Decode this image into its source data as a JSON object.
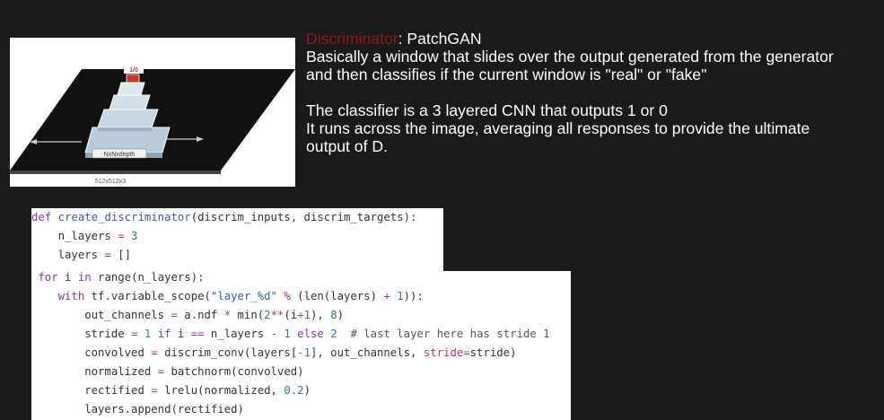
{
  "diagram": {
    "output_label": "1/0",
    "layer_label": "NxNxdepth",
    "image_label": "512x512x3"
  },
  "description": {
    "title_accent": "Discriminator",
    "title_rest": ": PatchGAN",
    "paragraph1": "Basically a window that slides over the output generated from the generator and then classifies if the current window is \"real\" or \"fake\"",
    "paragraph2_line1": "The classifier is a 3 layered CNN that outputs 1 or 0",
    "paragraph2_line2": "It runs across the image, averaging all responses to provide the ultimate output of D."
  },
  "code": {
    "block1": [
      [
        [
          "kw",
          "def"
        ],
        [
          "t",
          " "
        ],
        [
          "fn",
          "create_discriminator"
        ],
        [
          "t",
          "(discrim_inputs, discrim_targets):"
        ]
      ],
      [
        [
          "t",
          "    n_layers "
        ],
        [
          "op",
          "="
        ],
        [
          "t",
          " "
        ],
        [
          "num",
          "3"
        ]
      ],
      [
        [
          "t",
          "    layers "
        ],
        [
          "op",
          "="
        ],
        [
          "t",
          " []"
        ]
      ]
    ],
    "block2": [
      [
        [
          "t",
          " "
        ],
        [
          "kw",
          "for"
        ],
        [
          "t",
          " i "
        ],
        [
          "kw",
          "in"
        ],
        [
          "t",
          " range(n_layers):"
        ]
      ],
      [
        [
          "t",
          "    "
        ],
        [
          "kw",
          "with"
        ],
        [
          "t",
          " tf.variable_scope("
        ],
        [
          "st",
          "\"layer_%d\""
        ],
        [
          "t",
          " "
        ],
        [
          "op",
          "%"
        ],
        [
          "t",
          " (len(layers) "
        ],
        [
          "op",
          "+"
        ],
        [
          "t",
          " "
        ],
        [
          "num",
          "1"
        ],
        [
          "t",
          "))"
        ],
        [
          "t",
          ":"
        ]
      ],
      [
        [
          "t",
          "        out_channels "
        ],
        [
          "op",
          "="
        ],
        [
          "t",
          " a.ndf "
        ],
        [
          "op",
          "*"
        ],
        [
          "t",
          " min("
        ],
        [
          "num",
          "2"
        ],
        [
          "op",
          "**"
        ],
        [
          "t",
          "(i"
        ],
        [
          "op",
          "+"
        ],
        [
          "num",
          "1"
        ],
        [
          "t",
          "), "
        ],
        [
          "num",
          "8"
        ],
        [
          "t",
          ")"
        ]
      ],
      [
        [
          "t",
          "        stride "
        ],
        [
          "op",
          "="
        ],
        [
          "t",
          " "
        ],
        [
          "num",
          "1"
        ],
        [
          "t",
          " "
        ],
        [
          "kw",
          "if"
        ],
        [
          "t",
          " i "
        ],
        [
          "op",
          "=="
        ],
        [
          "t",
          " n_layers "
        ],
        [
          "op",
          "-"
        ],
        [
          "t",
          " "
        ],
        [
          "num",
          "1"
        ],
        [
          "t",
          " "
        ],
        [
          "kw",
          "else"
        ],
        [
          "t",
          " "
        ],
        [
          "num",
          "2"
        ],
        [
          "t",
          "  "
        ],
        [
          "cm",
          "# last layer here has stride 1"
        ]
      ],
      [
        [
          "t",
          "        convolved "
        ],
        [
          "op",
          "="
        ],
        [
          "t",
          " discrim_conv(layers["
        ],
        [
          "op",
          "-"
        ],
        [
          "num",
          "1"
        ],
        [
          "t",
          "], out_channels, "
        ],
        [
          "kwarg",
          "stride"
        ],
        [
          "op",
          "="
        ],
        [
          "t",
          "stride)"
        ]
      ],
      [
        [
          "t",
          "        normalized "
        ],
        [
          "op",
          "="
        ],
        [
          "t",
          " batchnorm(convolved)"
        ]
      ],
      [
        [
          "t",
          "        rectified "
        ],
        [
          "op",
          "="
        ],
        [
          "t",
          " lrelu(normalized, "
        ],
        [
          "num",
          "0.2"
        ],
        [
          "t",
          ")"
        ]
      ],
      [
        [
          "t",
          "        layers.append(rectified)"
        ]
      ]
    ]
  },
  "colors": {
    "background": "#1a1a1a",
    "accent": "#8c1c1c",
    "text": "#ffffff",
    "keyword": "#8b2ebf",
    "function": "#2f5fa8",
    "number": "#2f6fb0",
    "operator": "#b030a0"
  }
}
